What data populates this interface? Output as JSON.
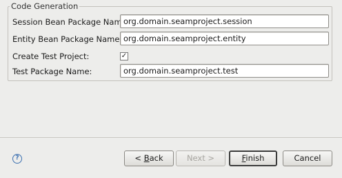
{
  "code_generation": {
    "title": "Code Generation",
    "session_package_label": "Session Bean Package Name:",
    "session_package_value": "org.domain.seamproject.session",
    "entity_package_label": "Entity Bean Package Name:",
    "entity_package_value": "org.domain.seamproject.entity",
    "create_test_label": "Create Test Project:",
    "create_test_checked": "✓",
    "test_package_label": "Test Package Name:",
    "test_package_value": "org.domain.seamproject.test"
  },
  "footer": {
    "help_icon": "?",
    "back_prefix": "< ",
    "back_mnemonic": "B",
    "back_rest": "ack",
    "next_label": "Next >",
    "finish_mnemonic": "F",
    "finish_rest": "inish",
    "cancel_label": "Cancel"
  }
}
